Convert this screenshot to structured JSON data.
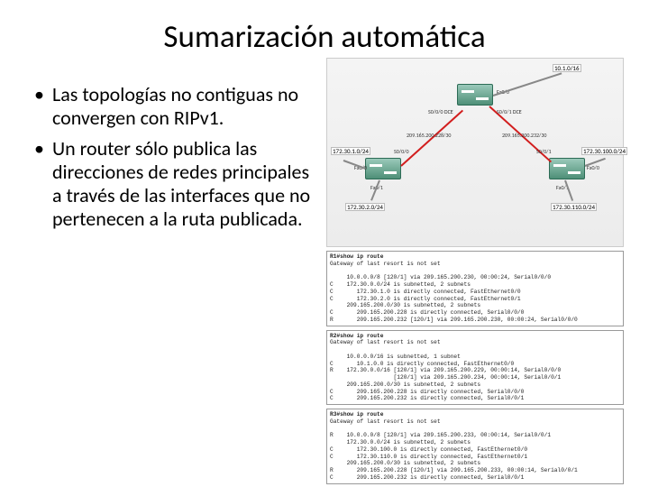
{
  "title": "Sumarización automática",
  "bullets": [
    "Las topologías no contiguas no convergen con RIPv1.",
    "Un router sólo publica las direcciones de redes principales a través de las interfaces que no pertenecen a la ruta publicada."
  ],
  "topology": {
    "labels": {
      "top_net": "10.1.0/16",
      "left_router_net": "172.30.1.0/24",
      "r1_lan2": "172.30.2.0/24",
      "r2_s000": "S0/0/0 DCE",
      "r2_s001": "S0/0/1 DCE",
      "wan_left": "209.165.200.228/30",
      "wan_right": "209.165.200.232/30",
      "r1_fa00": "Fa0/0",
      "r1_fa01": "Fa0/1",
      "r1_s000": "S0/0/0",
      "r3_s001": "S0/0/1",
      "r3_fa00": "Fa0/0",
      "r3_fa01": "Fa0/1",
      "r3_net1": "172.30.100.0/24",
      "r3_net2": "172.30.110.0/24",
      "r2_fa00": "Fa0/0"
    }
  },
  "cli1": {
    "prompt": "R1#show ip route",
    "body": "Gateway of last resort is not set\n\n     10.0.0.0/8 [120/1] via 209.165.200.230, 00:00:24, Serial0/0/0\nC    172.30.0.0/24 is subnetted, 2 subnets\nC       172.30.1.0 is directly connected, FastEthernet0/0\nC       172.30.2.0 is directly connected, FastEthernet0/1\n     209.165.200.0/30 is subnetted, 2 subnets\nC       209.165.200.228 is directly connected, Serial0/0/0\nR       209.165.200.232 [120/1] via 209.165.200.230, 00:00:24, Serial0/0/0"
  },
  "cli2": {
    "prompt": "R2#show ip route",
    "body": "Gateway of last resort is not set\n\n     10.0.0.0/16 is subnetted, 1 subnet\nC       10.1.0.0 is directly connected, FastEthernet0/0\nR    172.30.0.0/16 [120/1] via 209.165.200.229, 00:00:14, Serial0/0/0\n                   [120/1] via 209.165.200.234, 00:00:14, Serial0/0/1\n     209.165.200.0/30 is subnetted, 2 subnets\nC       209.165.200.228 is directly connected, Serial0/0/0\nC       209.165.200.232 is directly connected, Serial0/0/1"
  },
  "cli3": {
    "prompt": "R3#show ip route",
    "body": "Gateway of last resort is not set\n\nR    10.0.0.0/8 [120/1] via 209.165.200.233, 00:00:14, Serial0/0/1\n     172.30.0.0/24 is subnetted, 2 subnets\nC       172.30.100.0 is directly connected, FastEthernet0/0\nC       172.30.110.0 is directly connected, FastEthernet0/1\n     209.165.200.0/30 is subnetted, 2 subnets\nR       209.165.200.228 [120/1] via 209.165.200.233, 00:00:14, Serial0/0/1\nC       209.165.200.232 is directly connected, Serial0/0/1"
  }
}
